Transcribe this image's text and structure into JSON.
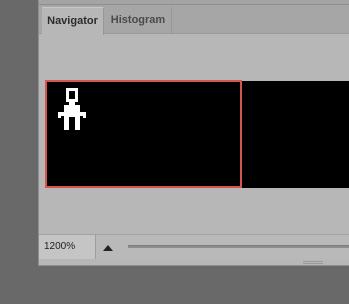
{
  "tabs": [
    {
      "label": "Navigator",
      "active": true
    },
    {
      "label": "Histogram",
      "active": false
    }
  ],
  "zoom": {
    "value": "1200%"
  },
  "icons": {
    "zoom_out": "small-mountain-icon",
    "grip": "resize-grip-icon"
  },
  "colors": {
    "view_rect": "#d9534f",
    "preview_bg": "#000000",
    "panel_bg": "#b7b7b7"
  }
}
